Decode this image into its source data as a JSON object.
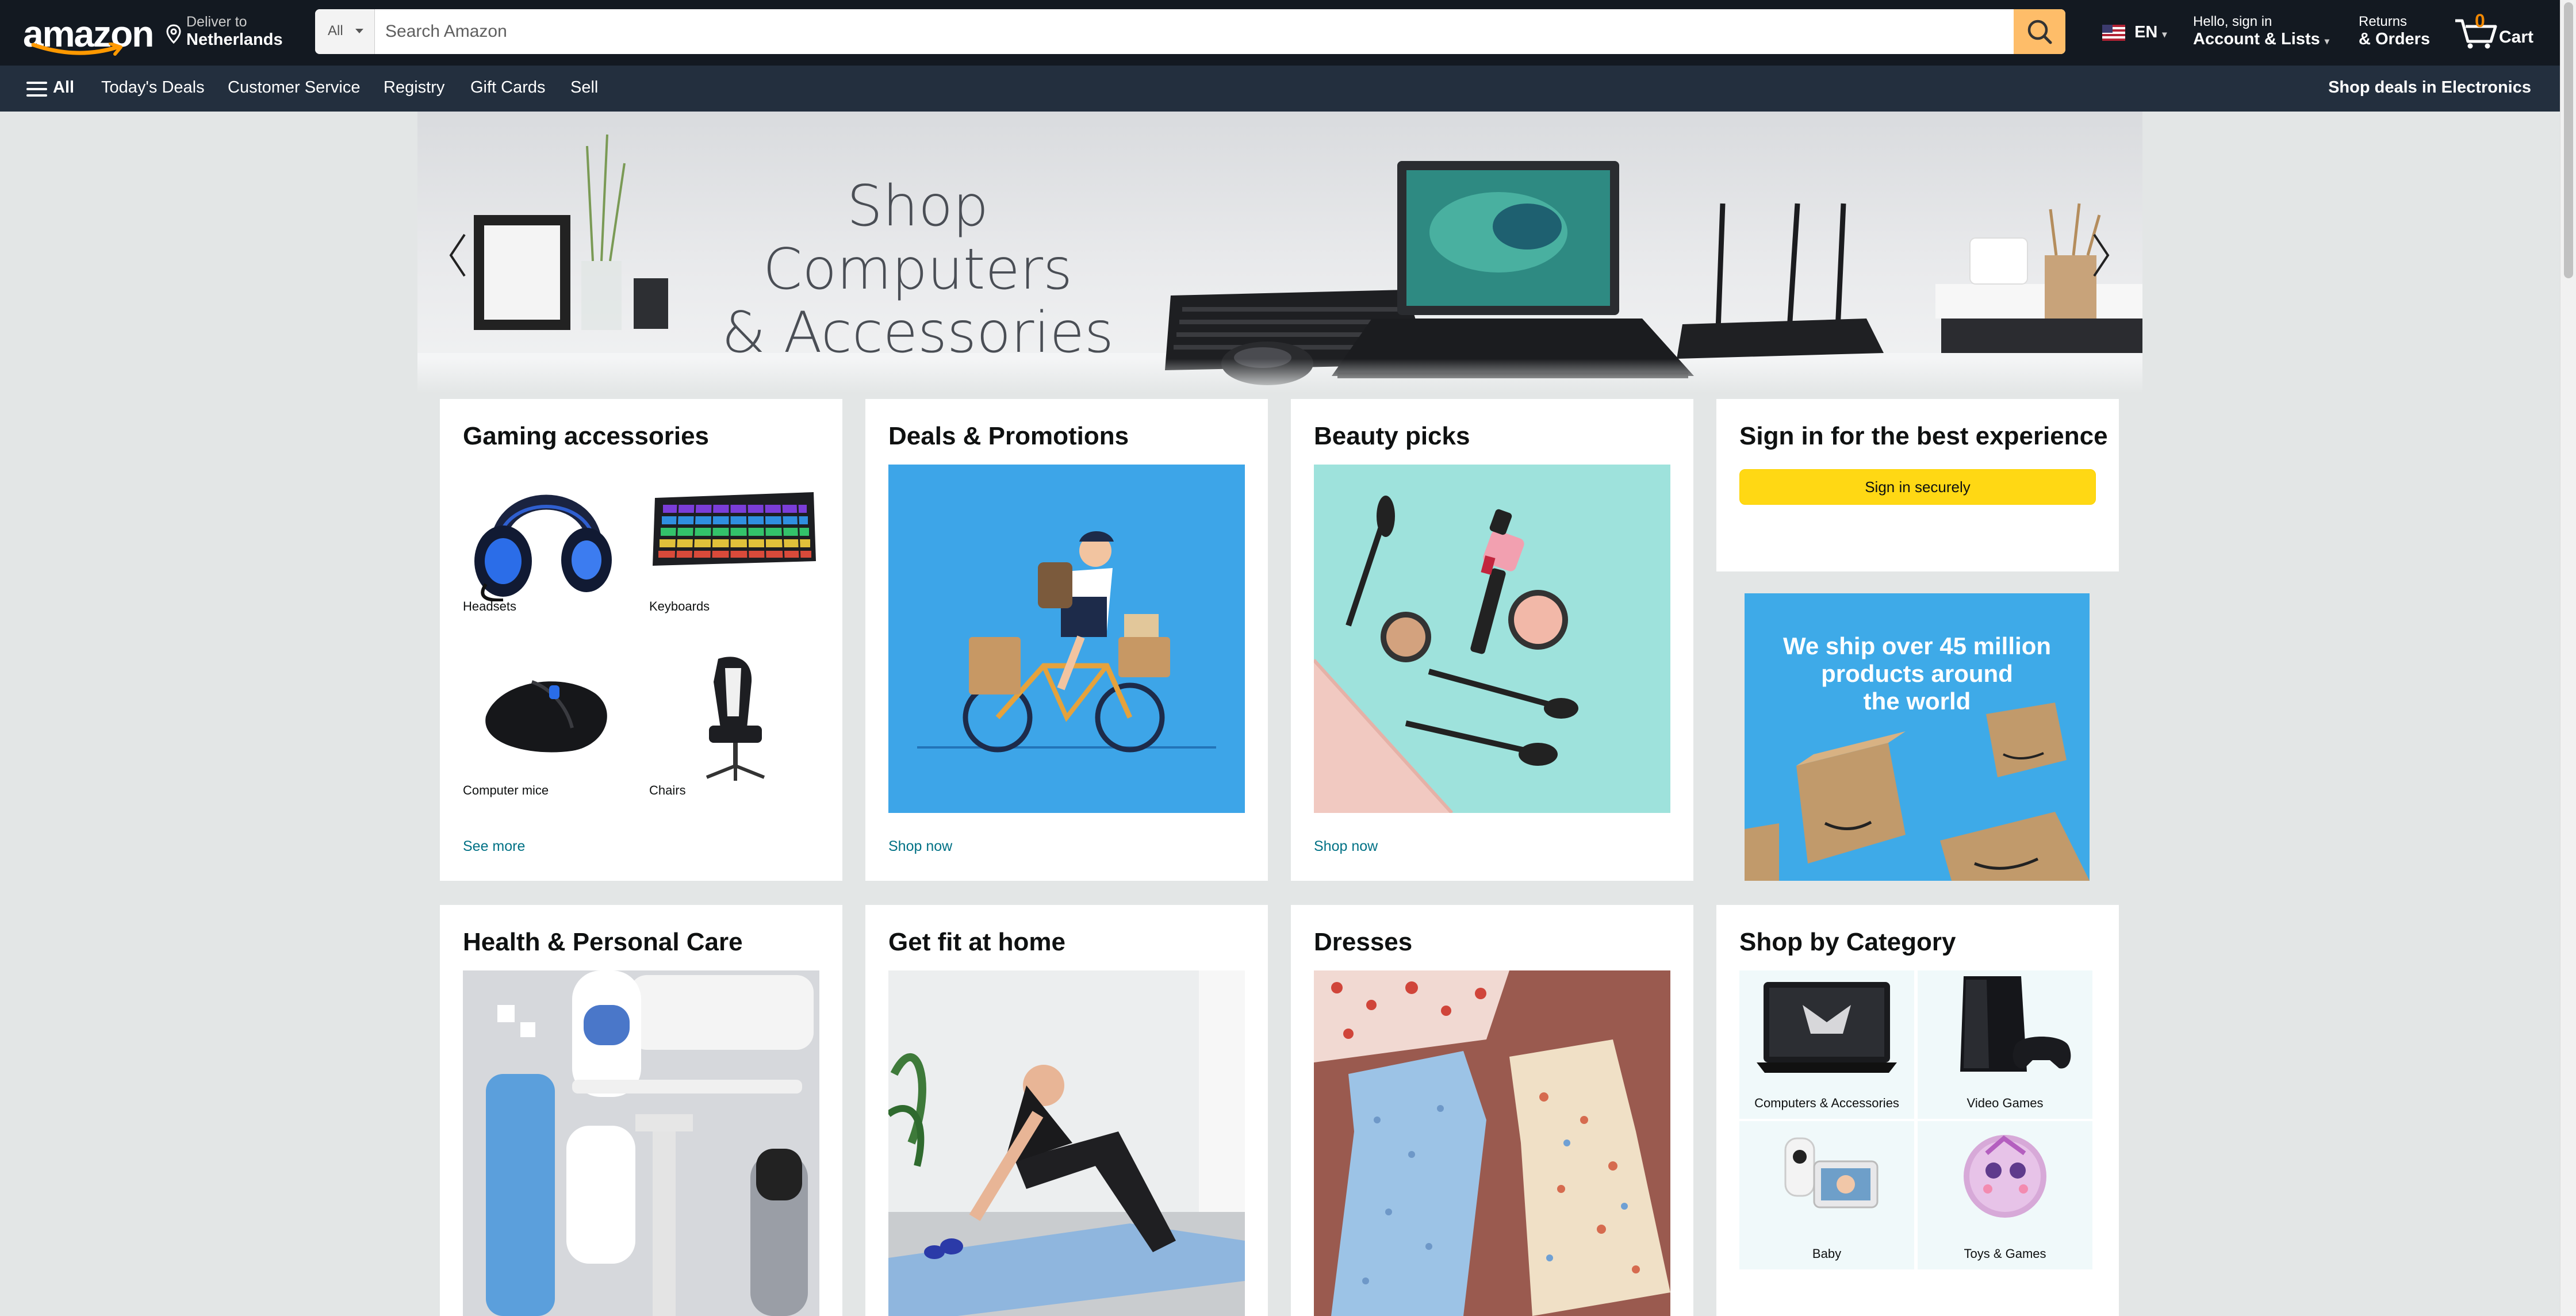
{
  "header": {
    "logo_text": "amazon",
    "deliver_to": "Deliver to",
    "deliver_location": "Netherlands",
    "search_category": "All",
    "search_placeholder": "Search Amazon",
    "language": "EN",
    "account_greeting": "Hello, sign in",
    "account_label": "Account & Lists",
    "returns_line1": "Returns",
    "returns_line2": "& Orders",
    "cart_count": "0",
    "cart_label": "Cart"
  },
  "subnav": {
    "all_label": "All",
    "items": [
      "Today's Deals",
      "Customer Service",
      "Registry",
      "Gift Cards",
      "Sell"
    ],
    "promo": "Shop deals in Electronics"
  },
  "hero": {
    "title_line1": "Shop Computers",
    "title_line2": "& Accessories"
  },
  "cards": {
    "gaming": {
      "title": "Gaming accessories",
      "tiles": [
        "Headsets",
        "Keyboards",
        "Computer mice",
        "Chairs"
      ],
      "link": "See more"
    },
    "deals": {
      "title": "Deals & Promotions",
      "link": "Shop now"
    },
    "beauty": {
      "title": "Beauty picks",
      "link": "Shop now"
    },
    "signin": {
      "title": "Sign in for the best experience",
      "button": "Sign in securely"
    },
    "ship_ad": {
      "line1": "We ship over 45 million",
      "line2": "products around",
      "line3": "the world"
    },
    "health": {
      "title": "Health & Personal Care"
    },
    "fitness": {
      "title": "Get fit at home"
    },
    "dresses": {
      "title": "Dresses"
    },
    "category": {
      "title": "Shop by Category",
      "tiles": [
        "Computers & Accessories",
        "Video Games",
        "Baby",
        "Toys & Games"
      ]
    }
  },
  "colors": {
    "nav_dark": "#131921",
    "nav_sub": "#232f3e",
    "search_button": "#febd69",
    "link": "#007185",
    "signin_button": "#ffd814",
    "page_bg": "#e3e6e6"
  },
  "icons": [
    "location-pin-icon",
    "search-icon",
    "flag-us-icon",
    "cart-icon",
    "hamburger-menu-icon",
    "chevron-left-icon",
    "chevron-right-icon"
  ]
}
